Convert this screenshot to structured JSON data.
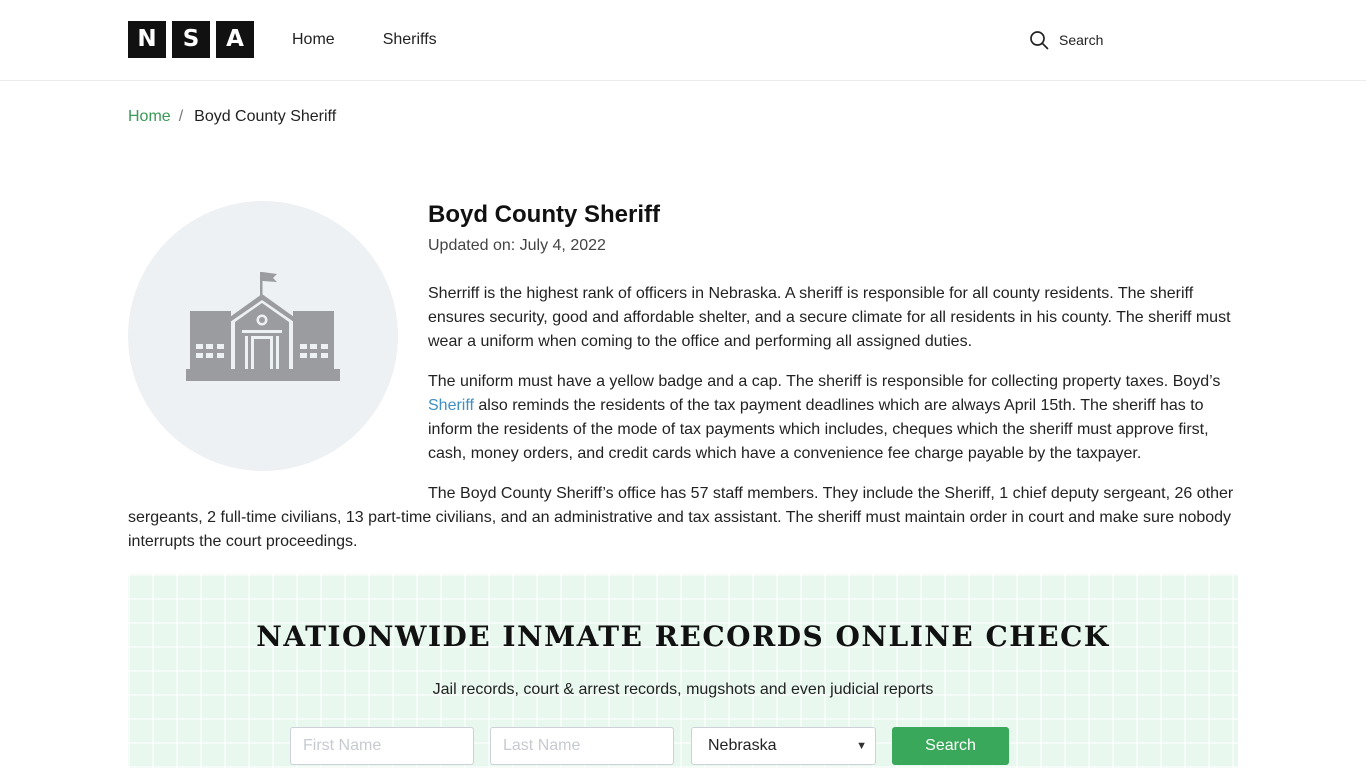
{
  "header": {
    "logo_letters": [
      "N",
      "S",
      "A"
    ],
    "nav": [
      {
        "label": "Home"
      },
      {
        "label": "Sheriffs"
      }
    ],
    "search_label": "Search"
  },
  "breadcrumb": {
    "home": "Home",
    "separator": "/",
    "current": "Boyd County Sheriff"
  },
  "hero": {
    "icon": "courthouse-icon"
  },
  "article": {
    "title": "Boyd County Sheriff",
    "updated": "Updated on: July 4, 2022",
    "paragraph_1": "Sherriff is the highest rank of officers in Nebraska. A sheriff is responsible for all county residents. The sheriff ensures security, good and affordable shelter, and a secure climate for all residents in his county. The sheriff must wear a uniform when coming to the office and performing all assigned duties.",
    "paragraph_2_before_link": "The uniform must have a yellow badge and a cap. The sheriff is responsible for collecting property taxes. Boyd’s ",
    "paragraph_2_link": "Sheriff",
    "paragraph_2_after_link": " also reminds the residents of the tax payment deadlines which are always April 15th. The sheriff has to inform the residents of the mode of tax payments which includes, cheques which the sheriff must approve first, cash, money orders, and credit cards which have a convenience fee charge payable by the taxpayer.",
    "paragraph_3": "The Boyd County Sheriff’s office has 57 staff members. They include the Sheriff, 1 chief deputy sergeant, 26 other sergeants, 2 full-time civilians, 13 part-time civilians, and an administrative and tax assistant.  The sheriff must maintain order in court and make sure nobody interrupts the court proceedings."
  },
  "records": {
    "title": "NATIONWIDE INMATE RECORDS ONLINE CHECK",
    "subtitle": "Jail records, court & arrest records, mugshots and even judicial reports",
    "first_name_placeholder": "First Name",
    "last_name_placeholder": "Last Name",
    "state_selected": "Nebraska",
    "search_button": "Search",
    "background_color": "#e9f8ef",
    "button_color": "#3aa85a"
  }
}
